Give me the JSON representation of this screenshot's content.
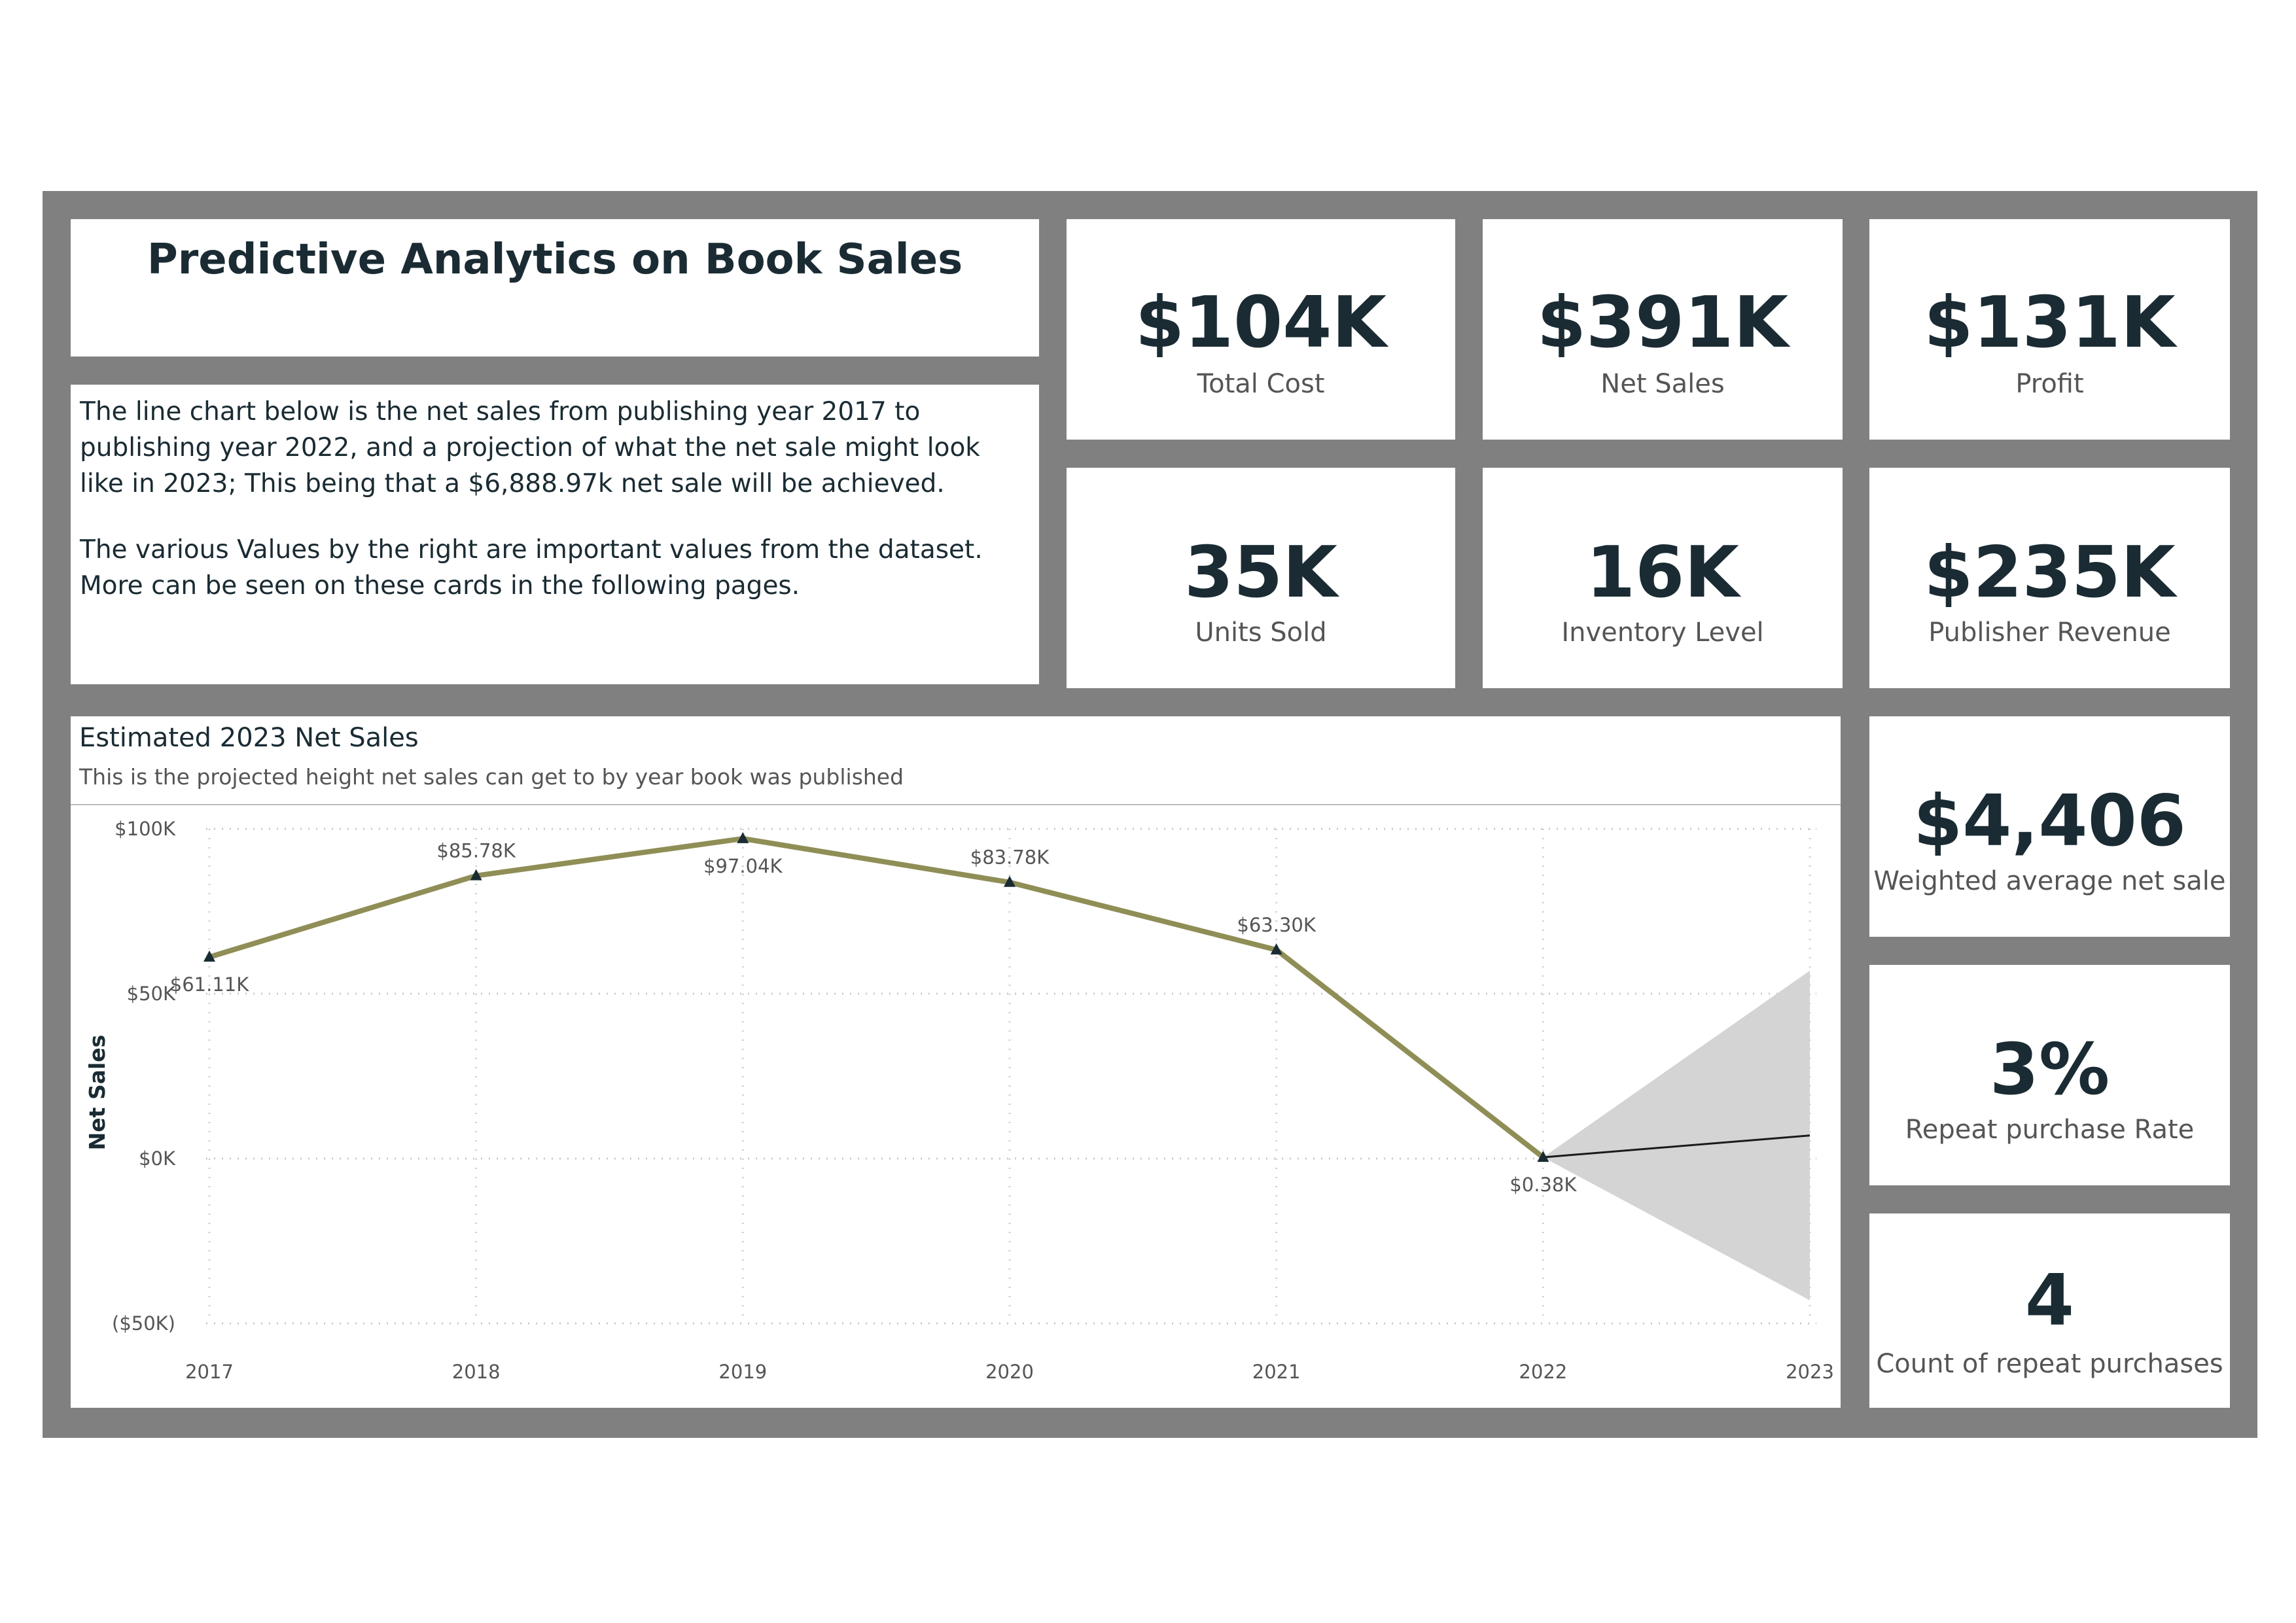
{
  "header": {
    "title": "Predictive Analytics on Book Sales"
  },
  "description": {
    "paragraph1": "The line chart below is the net sales from publishing year 2017 to publishing year 2022, and a projection of what the net sale might look like in 2023; This being that a $6,888.97k net sale will be achieved.",
    "paragraph2": "The various Values by the right are important values from the dataset. More can be seen on these cards in the following pages."
  },
  "cards": {
    "total_cost": {
      "value": "$104K",
      "label": "Total Cost"
    },
    "net_sales": {
      "value": "$391K",
      "label": "Net Sales"
    },
    "profit": {
      "value": "$131K",
      "label": "Profit"
    },
    "units_sold": {
      "value": "35K",
      "label": "Units Sold"
    },
    "inventory_level": {
      "value": "16K",
      "label": "Inventory Level"
    },
    "publisher_revenue": {
      "value": "$235K",
      "label": "Publisher Revenue"
    },
    "weighted_avg_net_sale": {
      "value": "$4,406",
      "label": "Weighted average net sale"
    },
    "repeat_purchase_rate": {
      "value": "3%",
      "label": "Repeat purchase Rate"
    },
    "repeat_purchases_count": {
      "value": "4",
      "label": "Count of repeat purchases"
    }
  },
  "colors": {
    "frame": "#808080",
    "line": "#8f8e56",
    "marker": "#1a2b33",
    "forecast_band": "#d4d4d4",
    "forecast_line": "#1a1a1a",
    "text_dark": "#1a2b33",
    "text_muted": "#555555"
  },
  "chart_data": {
    "type": "line",
    "title": "Estimated 2023 Net Sales",
    "subtitle": "This is the projected height net sales can get to by year book was published",
    "xlabel": "",
    "ylabel": "Net Sales",
    "x": [
      "2017",
      "2018",
      "2019",
      "2020",
      "2021",
      "2022",
      "2023"
    ],
    "ylim": [
      -50,
      100
    ],
    "y_unit": "K",
    "y_ticks": [
      -50,
      0,
      50,
      100
    ],
    "y_tick_labels": [
      "($50K)",
      "$0K",
      "$50K",
      "$100K"
    ],
    "grid": true,
    "series": [
      {
        "values": [
          61.11,
          85.78,
          97.04,
          83.78,
          63.3,
          0.38
        ],
        "labels": [
          "$61.11K",
          "$85.78K",
          "$97.04K",
          "$83.78K",
          "$63.30K",
          "$0.38K"
        ]
      }
    ],
    "forecast": {
      "x": [
        "2022",
        "2023"
      ],
      "values": [
        0.38,
        7
      ],
      "upper": [
        0.38,
        57
      ],
      "lower": [
        0.38,
        -43
      ]
    }
  }
}
